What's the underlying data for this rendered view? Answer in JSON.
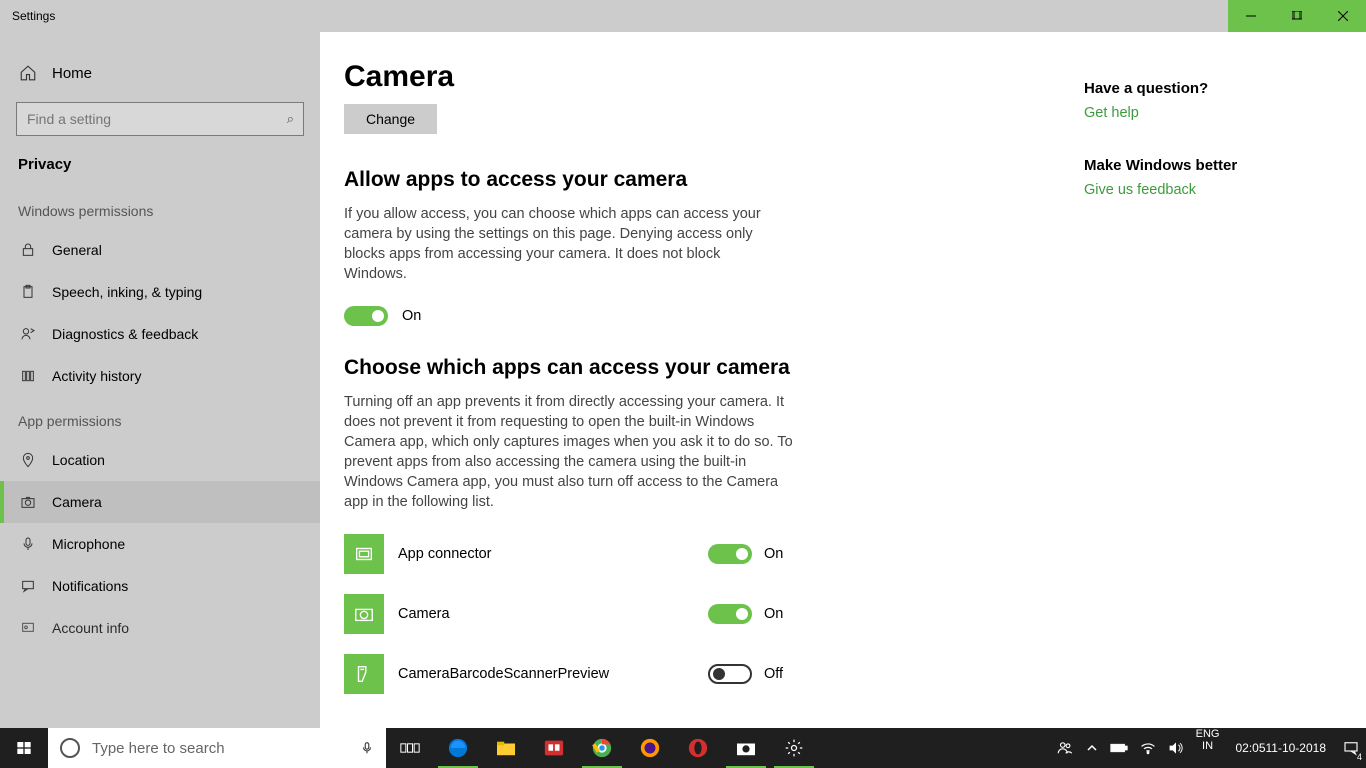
{
  "titlebar": {
    "label": "Settings"
  },
  "sidebar": {
    "home": "Home",
    "search_placeholder": "Find a setting",
    "section": "Privacy",
    "group1_label": "Windows permissions",
    "group1": [
      {
        "label": "General"
      },
      {
        "label": "Speech, inking, & typing"
      },
      {
        "label": "Diagnostics & feedback"
      },
      {
        "label": "Activity history"
      }
    ],
    "group2_label": "App permissions",
    "group2": [
      {
        "label": "Location"
      },
      {
        "label": "Camera"
      },
      {
        "label": "Microphone"
      },
      {
        "label": "Notifications"
      },
      {
        "label": "Account info"
      }
    ]
  },
  "main": {
    "title": "Camera",
    "change_btn": "Change",
    "allow_heading": "Allow apps to access your camera",
    "allow_desc": "If you allow access, you can choose which apps can access your camera by using the settings on this page. Denying access only blocks apps from accessing your camera. It does not block Windows.",
    "allow_state": "On",
    "choose_heading": "Choose which apps can access your camera",
    "choose_desc": "Turning off an app prevents it from directly accessing your camera. It does not prevent it from requesting to open the built-in Windows Camera app, which only captures images when you ask it to do so. To prevent apps from also accessing the camera using the built-in Windows Camera app, you must also turn off access to the Camera app in the following list.",
    "apps": [
      {
        "name": "App connector",
        "state": "On",
        "on": true
      },
      {
        "name": "Camera",
        "state": "On",
        "on": true
      },
      {
        "name": "CameraBarcodeScannerPreview",
        "state": "Off",
        "on": false
      }
    ]
  },
  "right": {
    "q_heading": "Have a question?",
    "q_link": "Get help",
    "f_heading": "Make Windows better",
    "f_link": "Give us feedback"
  },
  "taskbar": {
    "search_placeholder": "Type here to search",
    "lang1": "ENG",
    "lang2": "IN",
    "time": "02:05",
    "date": "11-10-2018",
    "notif_count": "4"
  }
}
